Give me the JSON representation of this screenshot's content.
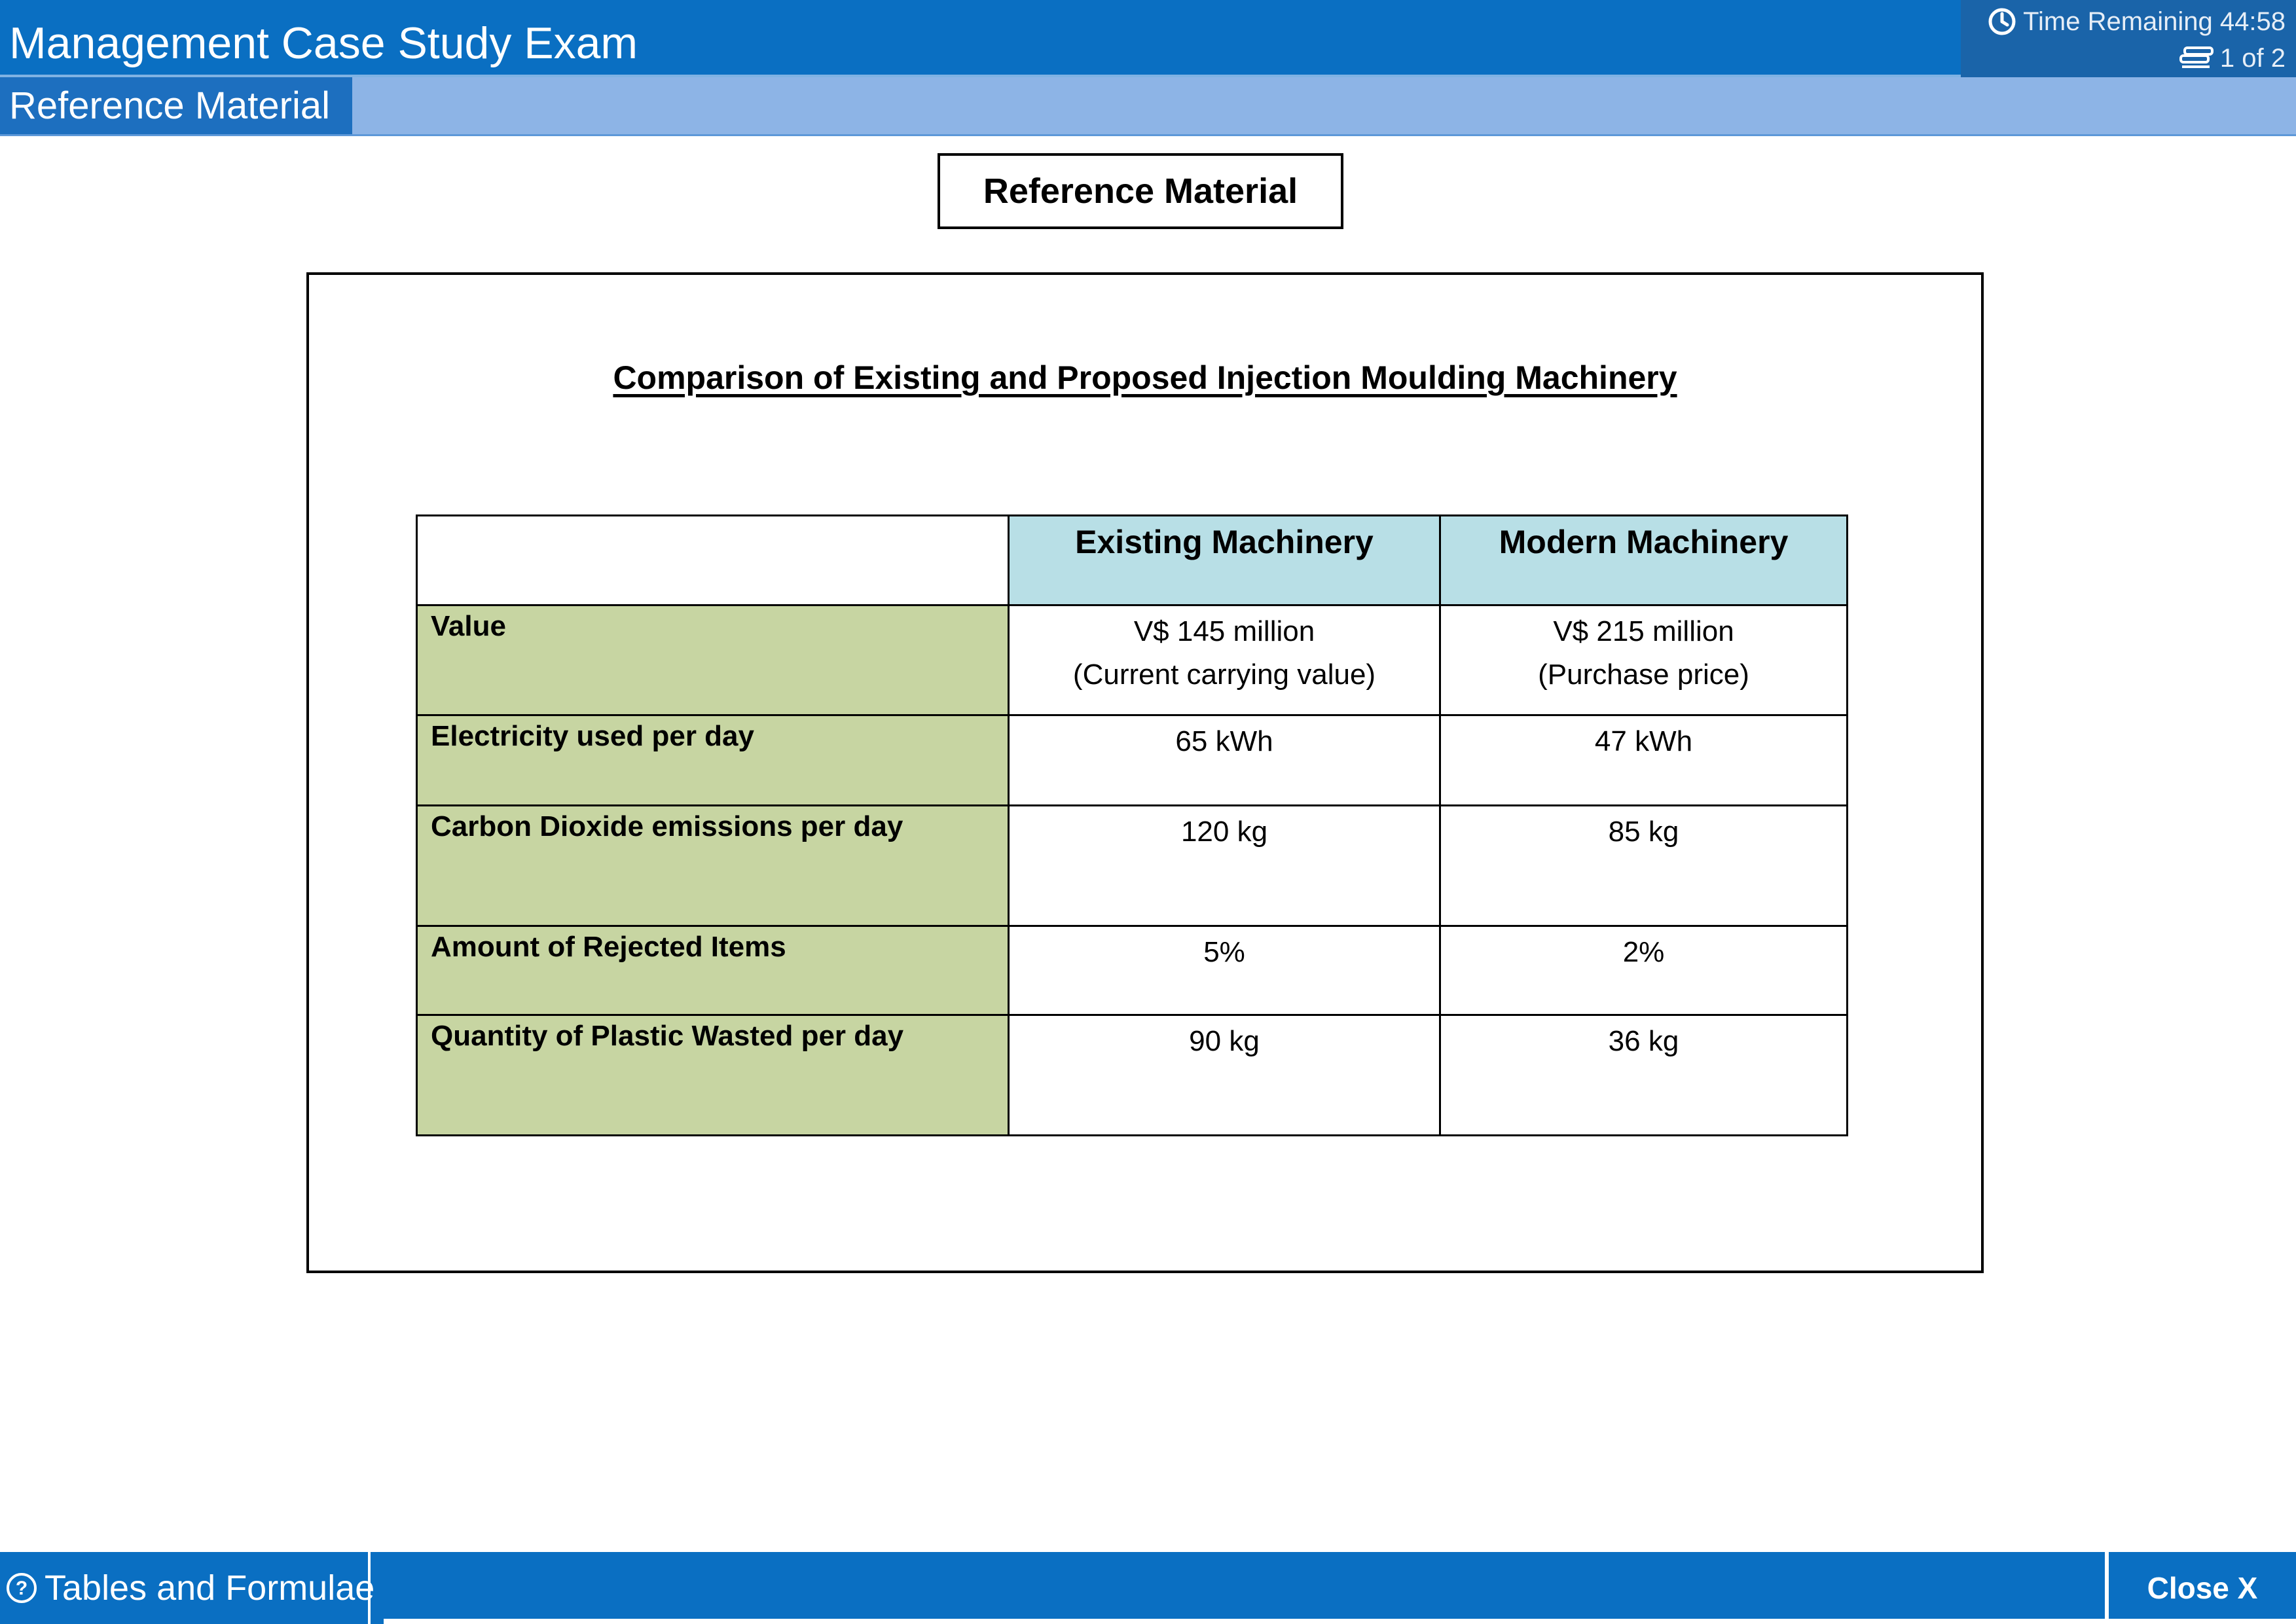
{
  "header": {
    "title": "Management Case Study Exam",
    "timer_text": "Time Remaining 44:58",
    "page_text": "1 of 2"
  },
  "subbar": {
    "tab_label": "Reference Material"
  },
  "content": {
    "heading": "Reference Material",
    "doc_title": "Comparison of Existing and Proposed Injection Moulding Machinery",
    "table": {
      "columns": [
        "",
        "Existing Machinery",
        "Modern Machinery"
      ],
      "rows": [
        {
          "label": "Value",
          "existing": [
            "V$ 145 million",
            "(Current carrying value)"
          ],
          "modern": [
            "V$ 215 million",
            "(Purchase price)"
          ]
        },
        {
          "label": "Electricity used per day",
          "existing": [
            "65 kWh"
          ],
          "modern": [
            "47 kWh"
          ]
        },
        {
          "label": "Carbon Dioxide emissions per day",
          "existing": [
            "120 kg"
          ],
          "modern": [
            "85 kg"
          ]
        },
        {
          "label": "Amount of Rejected Items",
          "existing": [
            "5%"
          ],
          "modern": [
            "2%"
          ]
        },
        {
          "label": "Quantity of Plastic Wasted per day",
          "existing": [
            "90 kg"
          ],
          "modern": [
            "36 kg"
          ]
        }
      ]
    }
  },
  "footer": {
    "tables_label": "Tables and Formulae",
    "close_label": "Close X"
  },
  "icons": {
    "timer": "clock-icon",
    "pager": "pages-icon",
    "help": "help-circle-icon"
  },
  "colors": {
    "header_blue": "#0a6fc2",
    "subbar_blue": "#8db4e6",
    "table_header": "#b8dfe6",
    "row_label": "#c7d5a2"
  }
}
